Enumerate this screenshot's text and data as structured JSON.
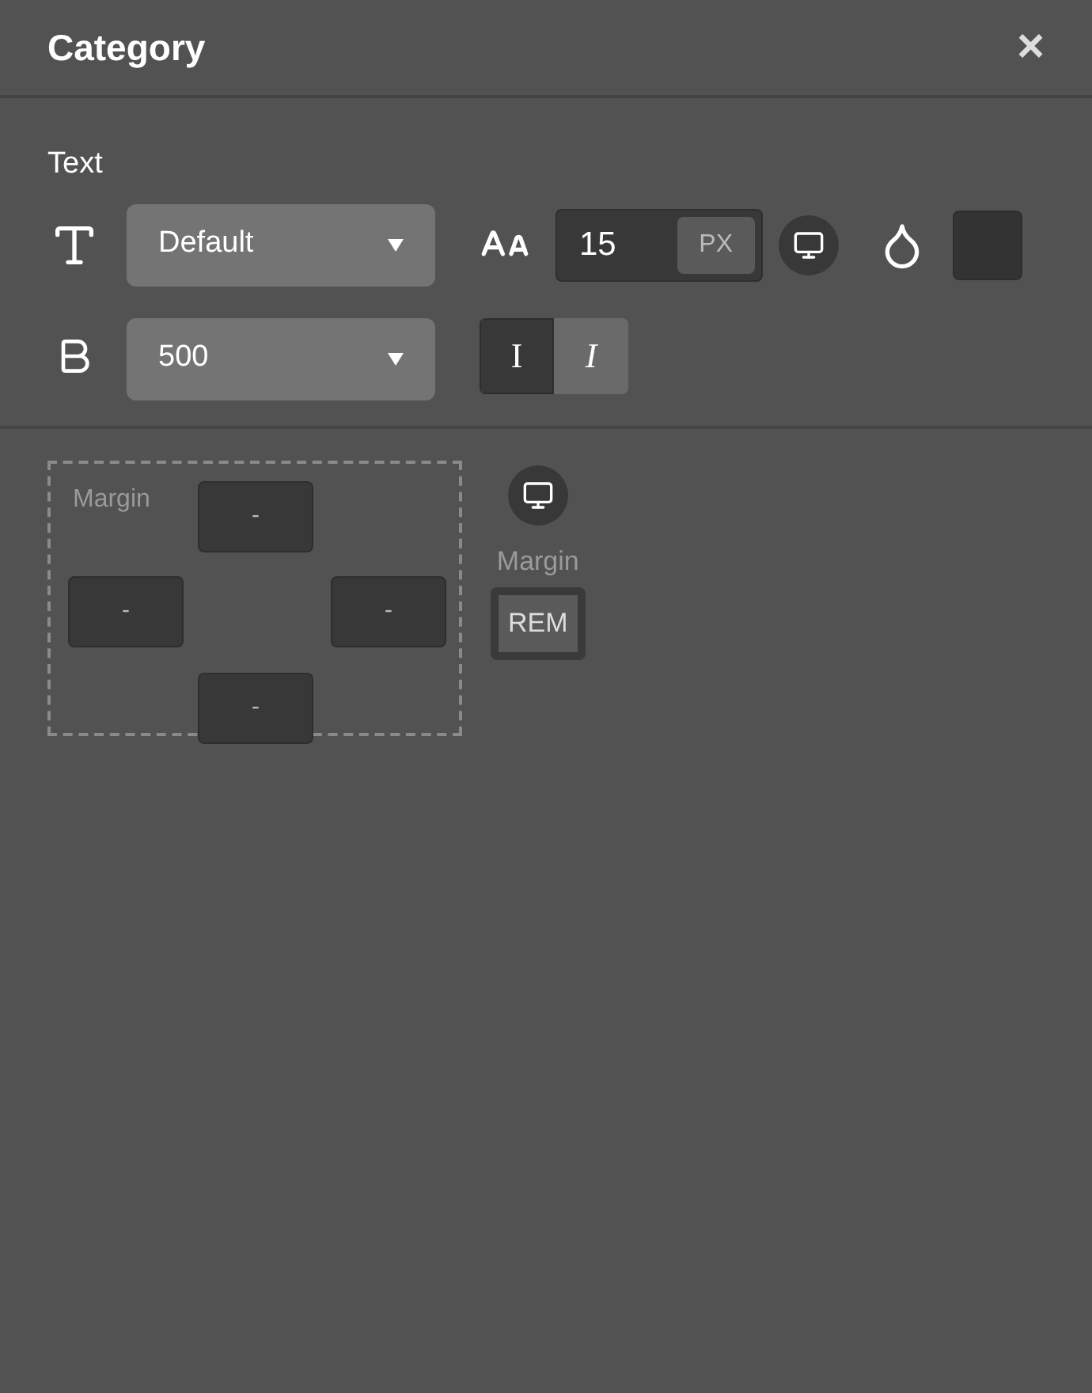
{
  "header": {
    "title": "Category",
    "close": "×"
  },
  "text_section": {
    "label": "Text",
    "font_family": {
      "value": "Default"
    },
    "font_size": {
      "value": "15",
      "unit": "PX"
    },
    "color_swatch": {
      "color": "#333333"
    },
    "font_weight": {
      "value": "500"
    },
    "style_toggle": [
      {
        "label": "I",
        "kind": "normal",
        "selected": true
      },
      {
        "label": "I",
        "kind": "italic",
        "selected": false
      }
    ]
  },
  "margin": {
    "label": "Margin",
    "top": "-",
    "left": "-",
    "right": "-",
    "bottom": "-",
    "side_label": "Margin",
    "unit": "REM"
  }
}
